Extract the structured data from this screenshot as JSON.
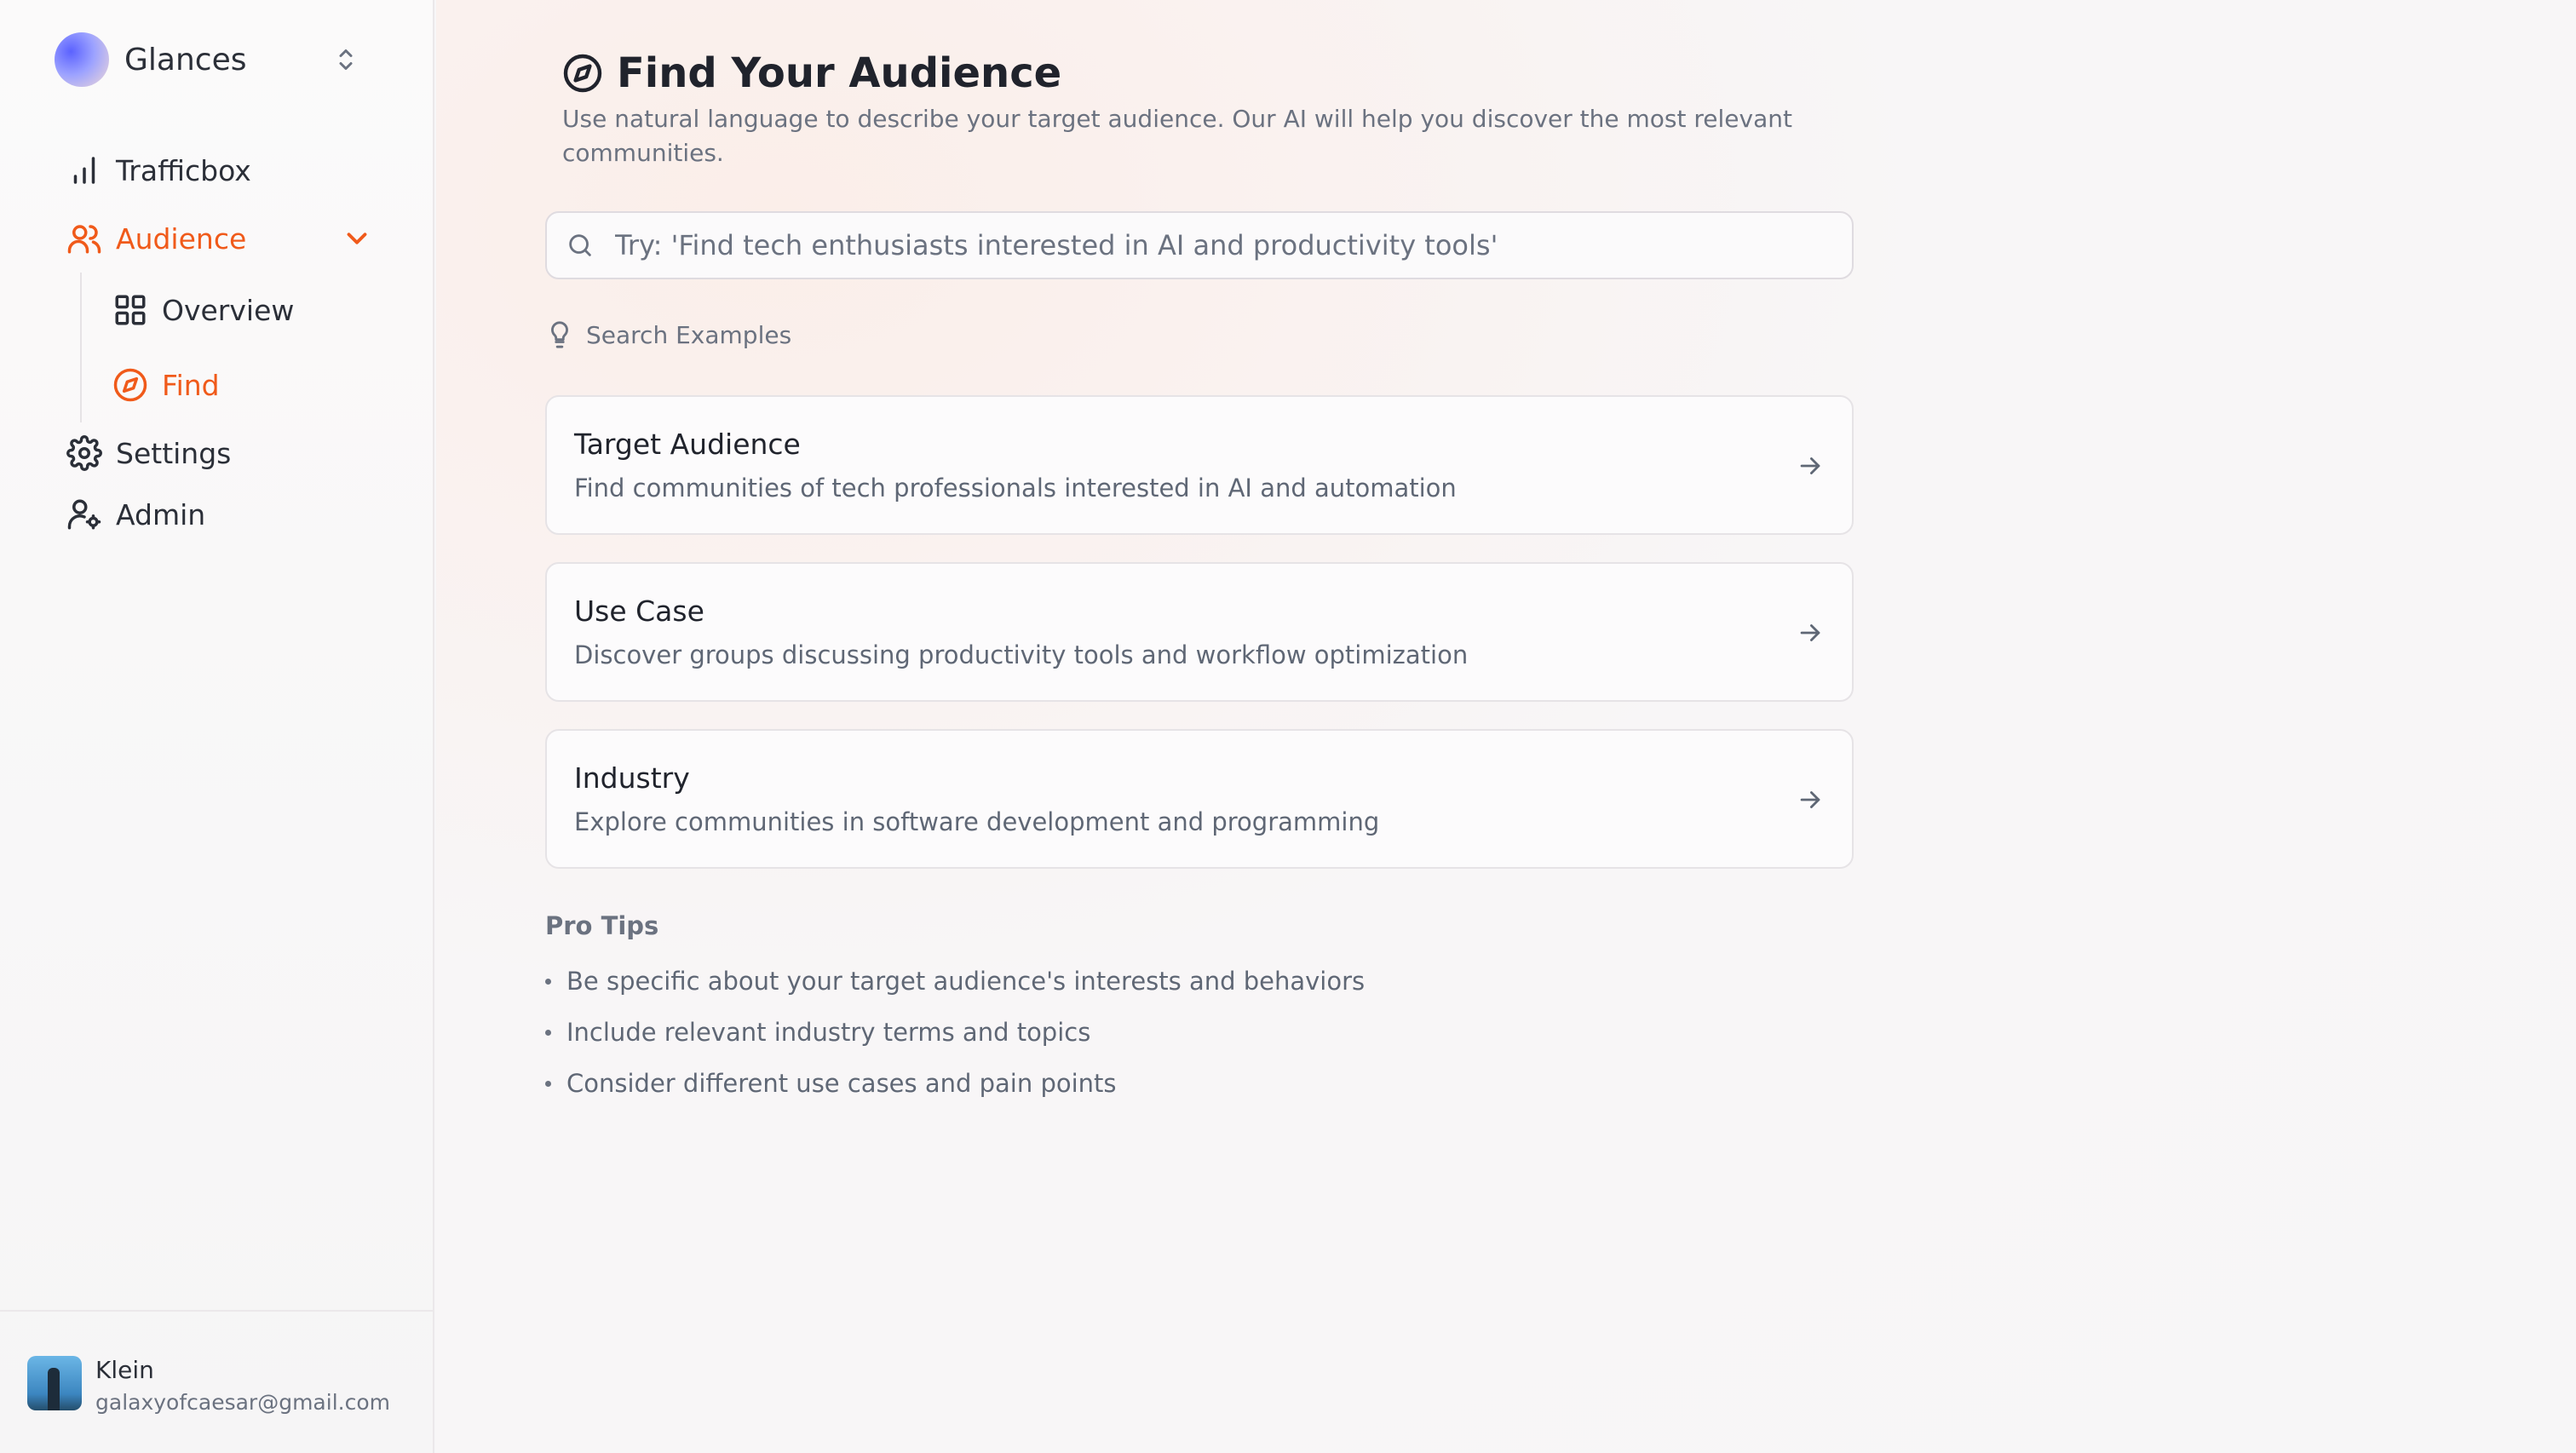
{
  "sidebar": {
    "brand": {
      "name": "Glances"
    },
    "nav": {
      "trafficbox": "Trafficbox",
      "audience": "Audience",
      "overview": "Overview",
      "find": "Find",
      "settings": "Settings",
      "admin": "Admin"
    },
    "user": {
      "name": "Klein",
      "email": "galaxyofcaesar@gmail.com"
    }
  },
  "main": {
    "title": "Find Your Audience",
    "subtitle": "Use natural language to describe your target audience. Our AI will help you discover the most relevant communities.",
    "search": {
      "value": "",
      "placeholder": "Try: 'Find tech enthusiasts interested in AI and productivity tools'"
    },
    "examples_label": "Search Examples",
    "examples": [
      {
        "title": "Target Audience",
        "desc": "Find communities of tech professionals interested in AI and automation"
      },
      {
        "title": "Use Case",
        "desc": "Discover groups discussing productivity tools and workflow optimization"
      },
      {
        "title": "Industry",
        "desc": "Explore communities in software development and programming"
      }
    ],
    "pro_tips": {
      "title": "Pro Tips",
      "items": [
        "Be specific about your target audience's interests and behaviors",
        "Include relevant industry terms and topics",
        "Consider different use cases and pain points"
      ]
    }
  },
  "colors": {
    "accent": "#f05a1a",
    "text": "#20232c",
    "muted": "#6b7280",
    "border": "#e6e3e6"
  },
  "icons": {
    "trafficbox": "bar-chart-icon",
    "audience": "users-icon",
    "overview": "grid-icon",
    "find": "compass-icon",
    "settings": "gear-icon",
    "admin": "user-cog-icon",
    "search": "search-icon",
    "examples": "lightbulb-icon",
    "card": "arrow-right-icon"
  }
}
